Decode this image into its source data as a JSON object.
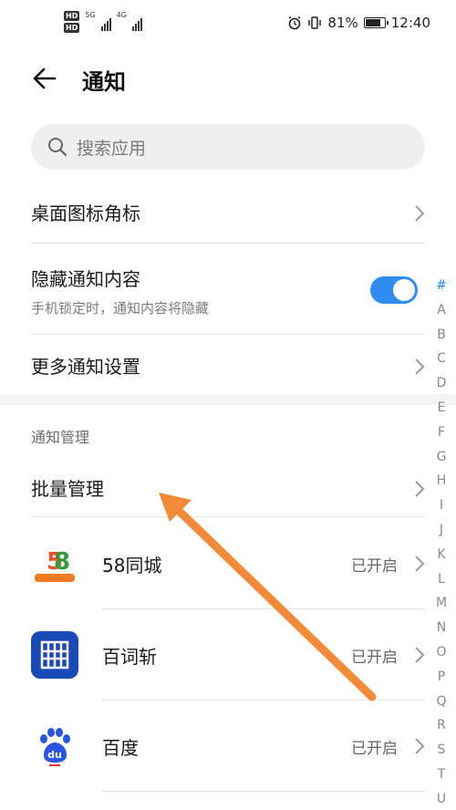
{
  "status_bar": {
    "hd_badges": [
      "HD",
      "HD"
    ],
    "net_1": "5G",
    "net_2": "4G",
    "battery_percent": "81%",
    "time": "12:40",
    "battery_level": 0.81
  },
  "header": {
    "title": "通知"
  },
  "search": {
    "placeholder": "搜索应用"
  },
  "settings": {
    "desktop_badge": "桌面图标角标",
    "hide_content": "隐藏通知内容",
    "hide_content_sub": "手机锁定时，通知内容将隐藏",
    "hide_content_on": true,
    "more_settings": "更多通知设置"
  },
  "section": {
    "title": "通知管理",
    "batch": "批量管理"
  },
  "apps": [
    {
      "name": "58同城",
      "status": "已开启",
      "icon": "58-logo-icon"
    },
    {
      "name": "百词斩",
      "status": "已开启",
      "icon": "baicizhan-icon"
    },
    {
      "name": "百度",
      "status": "已开启",
      "icon": "baidu-paw-icon"
    }
  ],
  "alphabet": [
    "#",
    "A",
    "B",
    "C",
    "D",
    "E",
    "F",
    "G",
    "H",
    "I",
    "J",
    "K",
    "L",
    "M",
    "N",
    "O",
    "P",
    "Q",
    "R",
    "S",
    "T",
    "U"
  ],
  "colors": {
    "accent": "#2f8cf0",
    "annotation_arrow": "#f28a3a"
  }
}
